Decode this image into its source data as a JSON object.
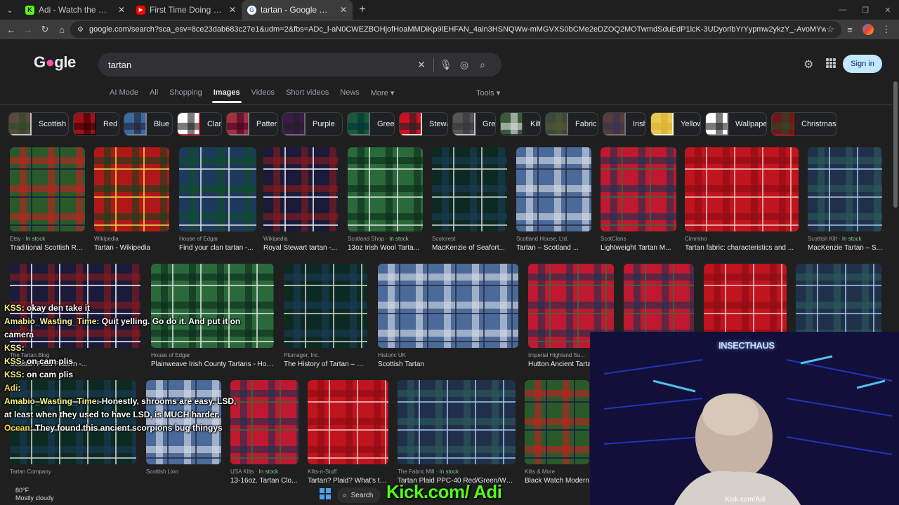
{
  "browser": {
    "tabs": [
      {
        "title": "Adi - Watch the VOD on Kick",
        "fav_color": "#53fc18",
        "fav_glyph": "K"
      },
      {
        "title": "First Time Doing Mushrooms -",
        "fav_color": "#ff0000",
        "fav_glyph": "▶"
      },
      {
        "title": "tartan - Google Search",
        "fav_color": "#ffffff",
        "fav_glyph": "G"
      }
    ],
    "url": "google.com/search?sca_esv=8ce23dab683c27e1&udm=2&fbs=ADc_l-aN0CWEZBOHjofHoaMMDiKp9lEHFAN_4ain3HSNQWw-mMGVXS0bCMe2eDZOQ2MOTwmdSduEdP1lcK-3UDyorlbYrYypmw2ykzY_-AvoMYwpWfEr14Erhh04IdDStdzOO32gPvzoJM1s-..."
  },
  "google": {
    "query": "tartan",
    "signin_label": "Sign in",
    "nav_tabs": [
      "AI Mode",
      "All",
      "Shopping",
      "Images",
      "Videos",
      "Short videos",
      "News",
      "More ▾"
    ],
    "active_tab": "Images",
    "tools_label": "Tools ▾",
    "chips": [
      "Scottish",
      "Red",
      "Blue",
      "Clan",
      "Pattern",
      "Purple",
      "Green",
      "Stewart",
      "Grey",
      "Kilt",
      "Fabric",
      "Irish",
      "Yellow",
      "Wallpaper",
      "Christmas"
    ],
    "row1": [
      {
        "source": "Etsy",
        "stock": "In stock",
        "caption": "Traditional Scottish R..."
      },
      {
        "source": "Wikipedia",
        "stock": "",
        "caption": "Tartan - Wikipedia"
      },
      {
        "source": "House of Edgar",
        "stock": "",
        "caption": "Find your clan tartan -..."
      },
      {
        "source": "Wikipedia",
        "stock": "",
        "caption": "Royal Stewart tartan -..."
      },
      {
        "source": "Scotland Shop",
        "stock": "In stock",
        "caption": "13oz Irish Wool Tarta..."
      },
      {
        "source": "Scotcrest",
        "stock": "",
        "caption": "MacKenzie of Seafort..."
      },
      {
        "source": "Scotland House, Ltd.",
        "stock": "",
        "caption": "Tartan – Scotland ..."
      },
      {
        "source": "ScotClans",
        "stock": "",
        "caption": "Lightweight Tartan M..."
      },
      {
        "source": "Cimmino",
        "stock": "",
        "caption": "Tartan fabric: characteristics and ..."
      },
      {
        "source": "Scottish Kilt",
        "stock": "In stock",
        "caption": "MacKenzie Tartan – S..."
      }
    ],
    "row2": [
      {
        "source": "The Tartan Blog",
        "stock": "",
        "caption": "Scottish Plaid Pattern -..."
      },
      {
        "source": "House of Edgar",
        "stock": "",
        "caption": "Plainweave Irish County Tartans - Hou..."
      },
      {
        "source": "Plumager, Inc.",
        "stock": "",
        "caption": "The History of Tartan – Pl..."
      },
      {
        "source": "Historic UK",
        "stock": "",
        "caption": "Scottish Tartan"
      },
      {
        "source": "Imperial Highland Su...",
        "stock": "",
        "caption": "Hutton Ancient Tartan"
      }
    ],
    "row3": [
      {
        "source": "Tartan Company",
        "stock": "",
        "caption": ""
      },
      {
        "source": "Scottish Lion",
        "stock": "",
        "caption": ""
      },
      {
        "source": "USA Kilts",
        "stock": "In stock",
        "caption": "13-16oz. Tartan Clo..."
      },
      {
        "source": "Kilts-n-Stuff",
        "stock": "",
        "caption": "Tartan? Plaid? What's th..."
      },
      {
        "source": "The Fabric Mill",
        "stock": "In stock",
        "caption": "Tartan Plaid PPC-40 Red/Green/Whi..."
      },
      {
        "source": "Kilts & More",
        "stock": "",
        "caption": "Black Watch Modern"
      }
    ]
  },
  "stream": {
    "chat": [
      {
        "user": "KSS",
        "text": ": okay den take it"
      },
      {
        "user": "Amabio_Wasting_Time",
        "text": ": Quit yelling. Go do it. And put it on camera"
      },
      {
        "user": "KSS",
        "text": ":"
      },
      {
        "user": "KSS",
        "text": ": on cam plis"
      },
      {
        "user": "KSS",
        "text": ": on cam plis"
      },
      {
        "user": "Adi",
        "text": ":"
      },
      {
        "user": "Amabio_Wasting_Time",
        "text": ": Honestly, shrooms are easy. LSD, at least when they used to have LSD, is MUCH harder."
      },
      {
        "user": "Ocean",
        "text": ": They found this ancient scorpions bug thingys"
      }
    ],
    "webcam_sign": "INSECTHAUS",
    "webcam_watermark": "Kick.com/Adi",
    "kick_banner": "Kick.com/ Adi",
    "taskbar_search": "Search",
    "weather_temp": "80°F",
    "weather_desc": "Mostly cloudy"
  }
}
